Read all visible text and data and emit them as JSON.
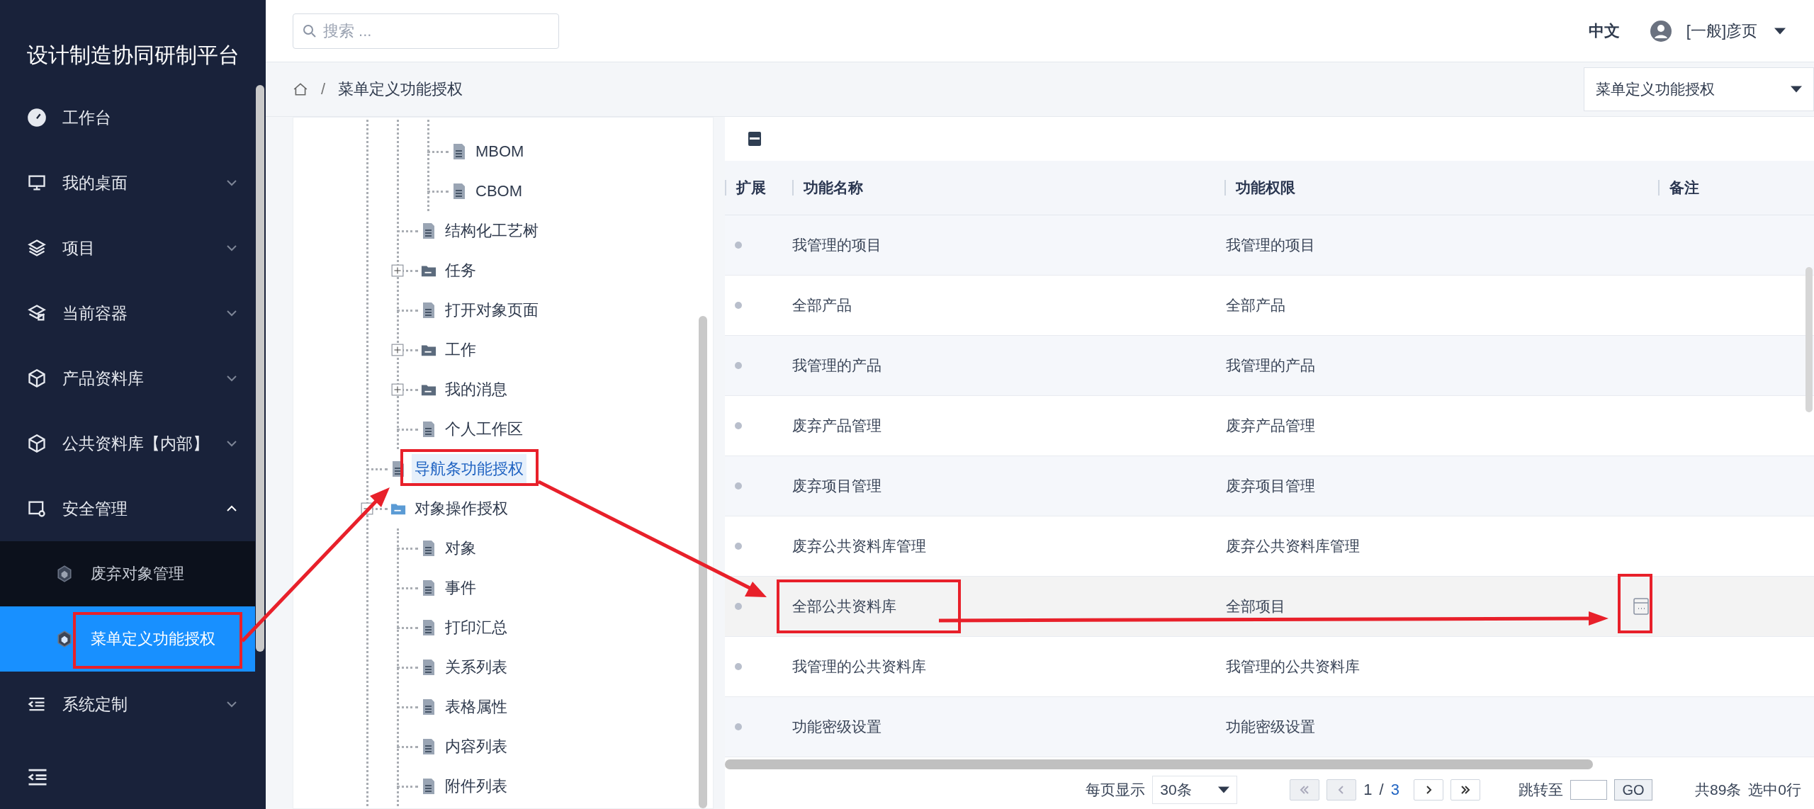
{
  "sidebar": {
    "title": "设计制造协同研制平台",
    "items": [
      {
        "label": "工作台",
        "expandable": false
      },
      {
        "label": "我的桌面",
        "expandable": true,
        "expanded": false
      },
      {
        "label": "项目",
        "expandable": true,
        "expanded": false
      },
      {
        "label": "当前容器",
        "expandable": true,
        "expanded": false
      },
      {
        "label": "产品资料库",
        "expandable": true,
        "expanded": false
      },
      {
        "label": "公共资料库【内部】",
        "expandable": true,
        "expanded": false
      },
      {
        "label": "安全管理",
        "expandable": true,
        "expanded": true,
        "children": [
          {
            "label": "废弃对象管理",
            "selected": false
          },
          {
            "label": "菜单定义功能授权",
            "selected": true
          }
        ]
      },
      {
        "label": "系统定制",
        "expandable": true,
        "expanded": false
      }
    ]
  },
  "topbar": {
    "search": {
      "placeholder": "搜索 ..."
    },
    "language": {
      "label": "中文",
      "selected": true
    },
    "user": "[一般]彦页"
  },
  "breadcrumb": {
    "separator": "/",
    "current": "菜单定义功能授权",
    "dropdown": "菜单定义功能授权"
  },
  "tree": {
    "nodes": [
      {
        "children": [
          {
            "children": [
              {
                "children": [
                  {
                    "label": "MBOM",
                    "kind": "doc",
                    "selected": false
                  },
                  {
                    "label": "CBOM",
                    "kind": "doc",
                    "selected": false
                  }
                ]
              },
              {
                "label": "结构化工艺树",
                "kind": "doc",
                "selected": false
              },
              {
                "label": "任务",
                "kind": "folder",
                "expanded": false,
                "selected": false
              },
              {
                "label": "打开对象页面",
                "kind": "doc",
                "selected": false
              },
              {
                "label": "工作",
                "kind": "folder",
                "expanded": false,
                "selected": false
              },
              {
                "label": "我的消息",
                "kind": "folder",
                "expanded": false,
                "selected": false
              },
              {
                "label": "个人工作区",
                "kind": "doc",
                "selected": false
              }
            ]
          },
          {
            "label": "导航条功能授权",
            "kind": "doc",
            "selected": true
          },
          {
            "label": "对象操作授权",
            "kind": "folder",
            "expanded": true,
            "selected": false,
            "children": [
              {
                "label": "对象",
                "kind": "doc",
                "selected": false
              },
              {
                "label": "事件",
                "kind": "doc",
                "selected": false
              },
              {
                "label": "打印汇总",
                "kind": "doc",
                "selected": false
              },
              {
                "label": "关系列表",
                "kind": "doc",
                "selected": false
              },
              {
                "label": "表格属性",
                "kind": "doc",
                "selected": false
              },
              {
                "label": "内容列表",
                "kind": "doc",
                "selected": false
              },
              {
                "label": "附件列表",
                "kind": "doc",
                "selected": false
              }
            ]
          }
        ]
      }
    ]
  },
  "table": {
    "columns": [
      "扩展",
      "功能名称",
      "功能权限",
      "备注"
    ],
    "rows": [
      {
        "name": "我管理的项目",
        "permission": "我管理的项目",
        "remark_icon": false,
        "hovered": false
      },
      {
        "name": "全部产品",
        "permission": "全部产品",
        "remark_icon": false,
        "hovered": false
      },
      {
        "name": "我管理的产品",
        "permission": "我管理的产品",
        "remark_icon": false,
        "hovered": false
      },
      {
        "name": "废弃产品管理",
        "permission": "废弃产品管理",
        "remark_icon": false,
        "hovered": false
      },
      {
        "name": "废弃项目管理",
        "permission": "废弃项目管理",
        "remark_icon": false,
        "hovered": false
      },
      {
        "name": "废弃公共资料库管理",
        "permission": "废弃公共资料库管理",
        "remark_icon": false,
        "hovered": false
      },
      {
        "name": "全部公共资料库",
        "permission": "全部项目",
        "remark_icon": true,
        "hovered": true
      },
      {
        "name": "我管理的公共资料库",
        "permission": "我管理的公共资料库",
        "remark_icon": false,
        "hovered": false
      },
      {
        "name": "功能密级设置",
        "permission": "功能密级设置",
        "remark_icon": false,
        "hovered": false
      }
    ]
  },
  "pagination": {
    "per_page_label": "每页显示",
    "per_page": "30条",
    "page": "1",
    "separator": "/",
    "total_pages": "3",
    "jump_label": "跳转至",
    "go": "GO",
    "total": "共89条",
    "selected_count": "选中0行"
  }
}
